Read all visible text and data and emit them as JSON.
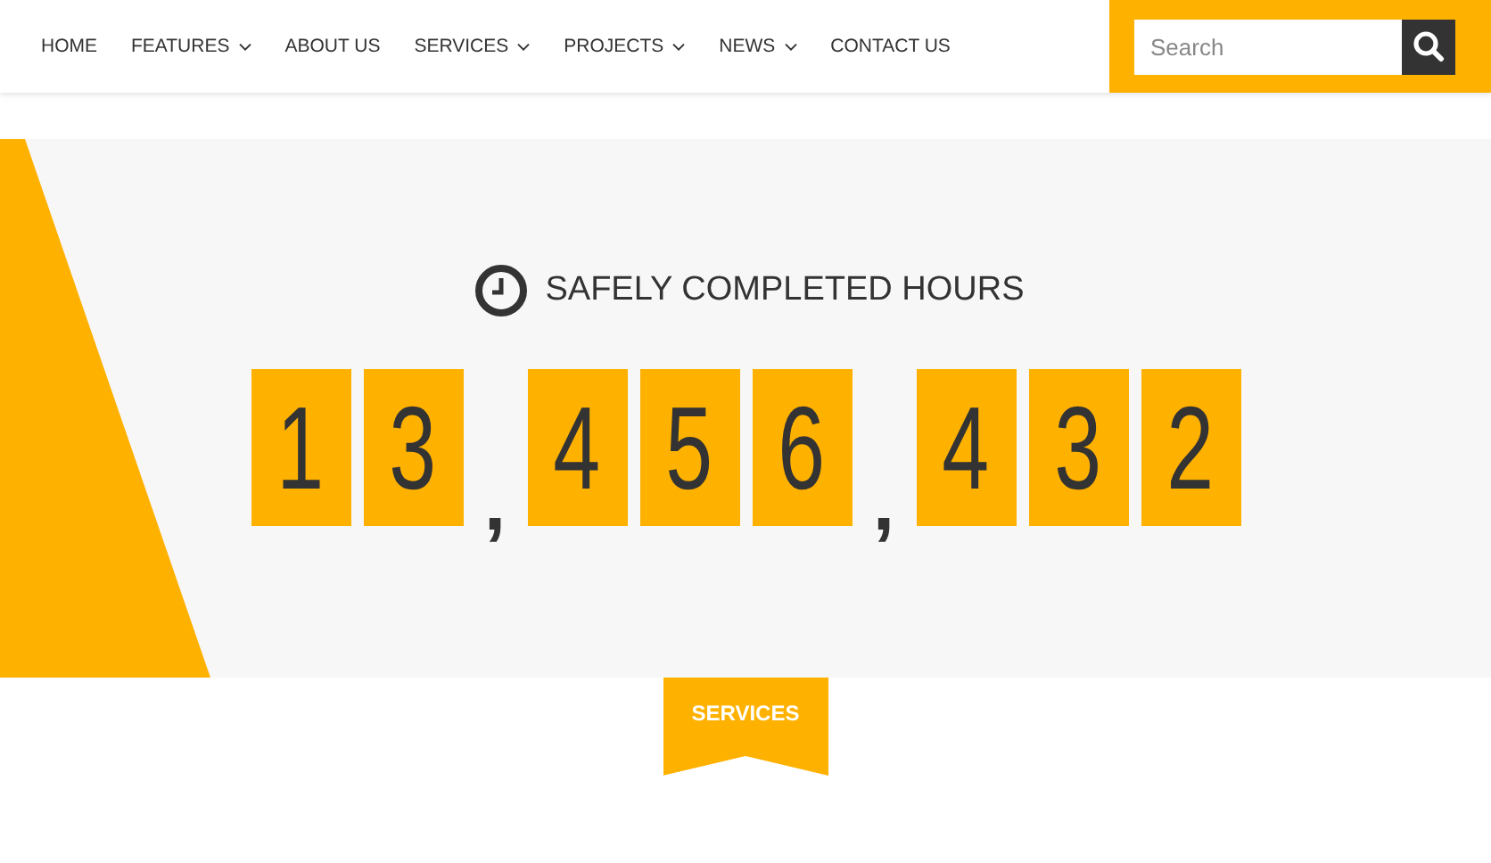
{
  "nav": {
    "items": [
      {
        "label": "HOME",
        "has_dropdown": false
      },
      {
        "label": "FEATURES",
        "has_dropdown": true
      },
      {
        "label": "ABOUT US",
        "has_dropdown": false
      },
      {
        "label": "SERVICES",
        "has_dropdown": true
      },
      {
        "label": "PROJECTS",
        "has_dropdown": true
      },
      {
        "label": "NEWS",
        "has_dropdown": true
      },
      {
        "label": "CONTACT US",
        "has_dropdown": false
      }
    ],
    "search": {
      "placeholder": "Search"
    }
  },
  "counter": {
    "title": "SAFELY COMPLETED HOURS",
    "characters": [
      {
        "kind": "digit",
        "text": "1"
      },
      {
        "kind": "digit",
        "text": "3"
      },
      {
        "kind": "separator",
        "text": ","
      },
      {
        "kind": "digit",
        "text": "4"
      },
      {
        "kind": "digit",
        "text": "5"
      },
      {
        "kind": "digit",
        "text": "6"
      },
      {
        "kind": "separator",
        "text": ","
      },
      {
        "kind": "digit",
        "text": "4"
      },
      {
        "kind": "digit",
        "text": "3"
      },
      {
        "kind": "digit",
        "text": "2"
      }
    ]
  },
  "section_ribbon": {
    "label": "SERVICES"
  }
}
